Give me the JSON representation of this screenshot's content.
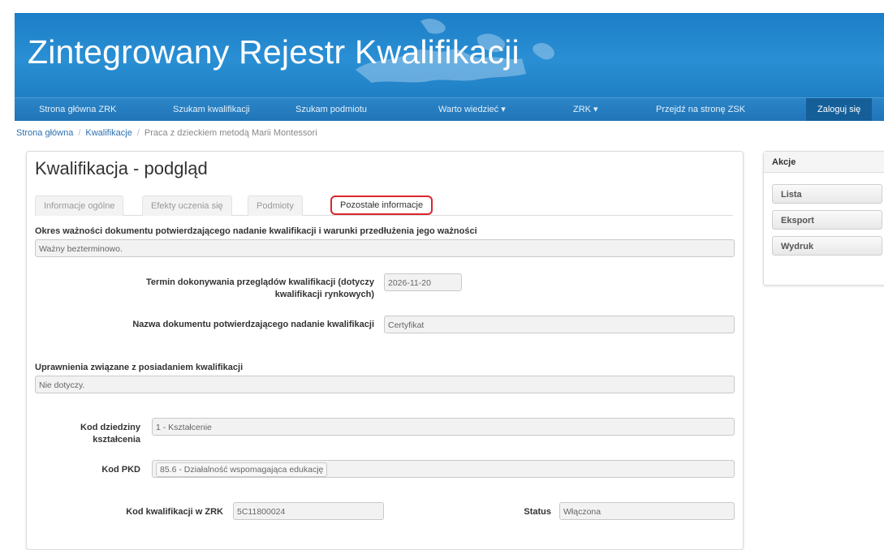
{
  "header": {
    "title": "Zintegrowany Rejestr Kwalifikacji"
  },
  "nav": {
    "items": [
      "Strona główna ZRK",
      "Szukam kwalifikacji",
      "Szukam podmiotu",
      "Warto wiedzieć ▾",
      "ZRK ▾",
      "Przejdź na stronę ZSK",
      "Zaloguj się"
    ]
  },
  "breadcrumb": {
    "home": "Strona główna",
    "section": "Kwalifikacje",
    "current": "Praca z dzieckiem metodą Marii Montessori"
  },
  "panel": {
    "title": "Kwalifikacja - podgląd",
    "tabs": [
      "Informacje ogólne",
      "Efekty uczenia się",
      "Podmioty",
      "Pozostałe informacje"
    ],
    "active_tab": "Pozostałe informacje"
  },
  "fields": {
    "validity_label": "Okres ważności dokumentu potwierdzającego nadanie kwalifikacji i warunki przedłużenia jego ważności",
    "validity_value": "Ważny bezterminowo.",
    "review_label_line1": "Termin dokonywania przeglądów kwalifikacji (dotyczy",
    "review_label_line2": "kwalifikacji rynkowych)",
    "review_value": "2026-11-20",
    "doc_name_label": "Nazwa dokumentu potwierdzającego nadanie kwalifikacji",
    "doc_name_value": "Certyfikat",
    "rights_label": "Uprawnienia związane z posiadaniem kwalifikacji",
    "rights_value": "Nie dotyczy.",
    "domain_code_label_line1": "Kod dziedziny",
    "domain_code_label_line2": "kształcenia",
    "domain_code_value": "1 - Kształcenie",
    "pkd_label": "Kod PKD",
    "pkd_value": "85.6 - Działalność wspomagająca edukację",
    "zrk_code_label": "Kod kwalifikacji w ZRK",
    "zrk_code_value": "5C11800024",
    "status_label": "Status",
    "status_value": "Włączona"
  },
  "actions": {
    "header": "Akcje",
    "buttons": [
      "Lista",
      "Eksport",
      "Wydruk"
    ]
  }
}
